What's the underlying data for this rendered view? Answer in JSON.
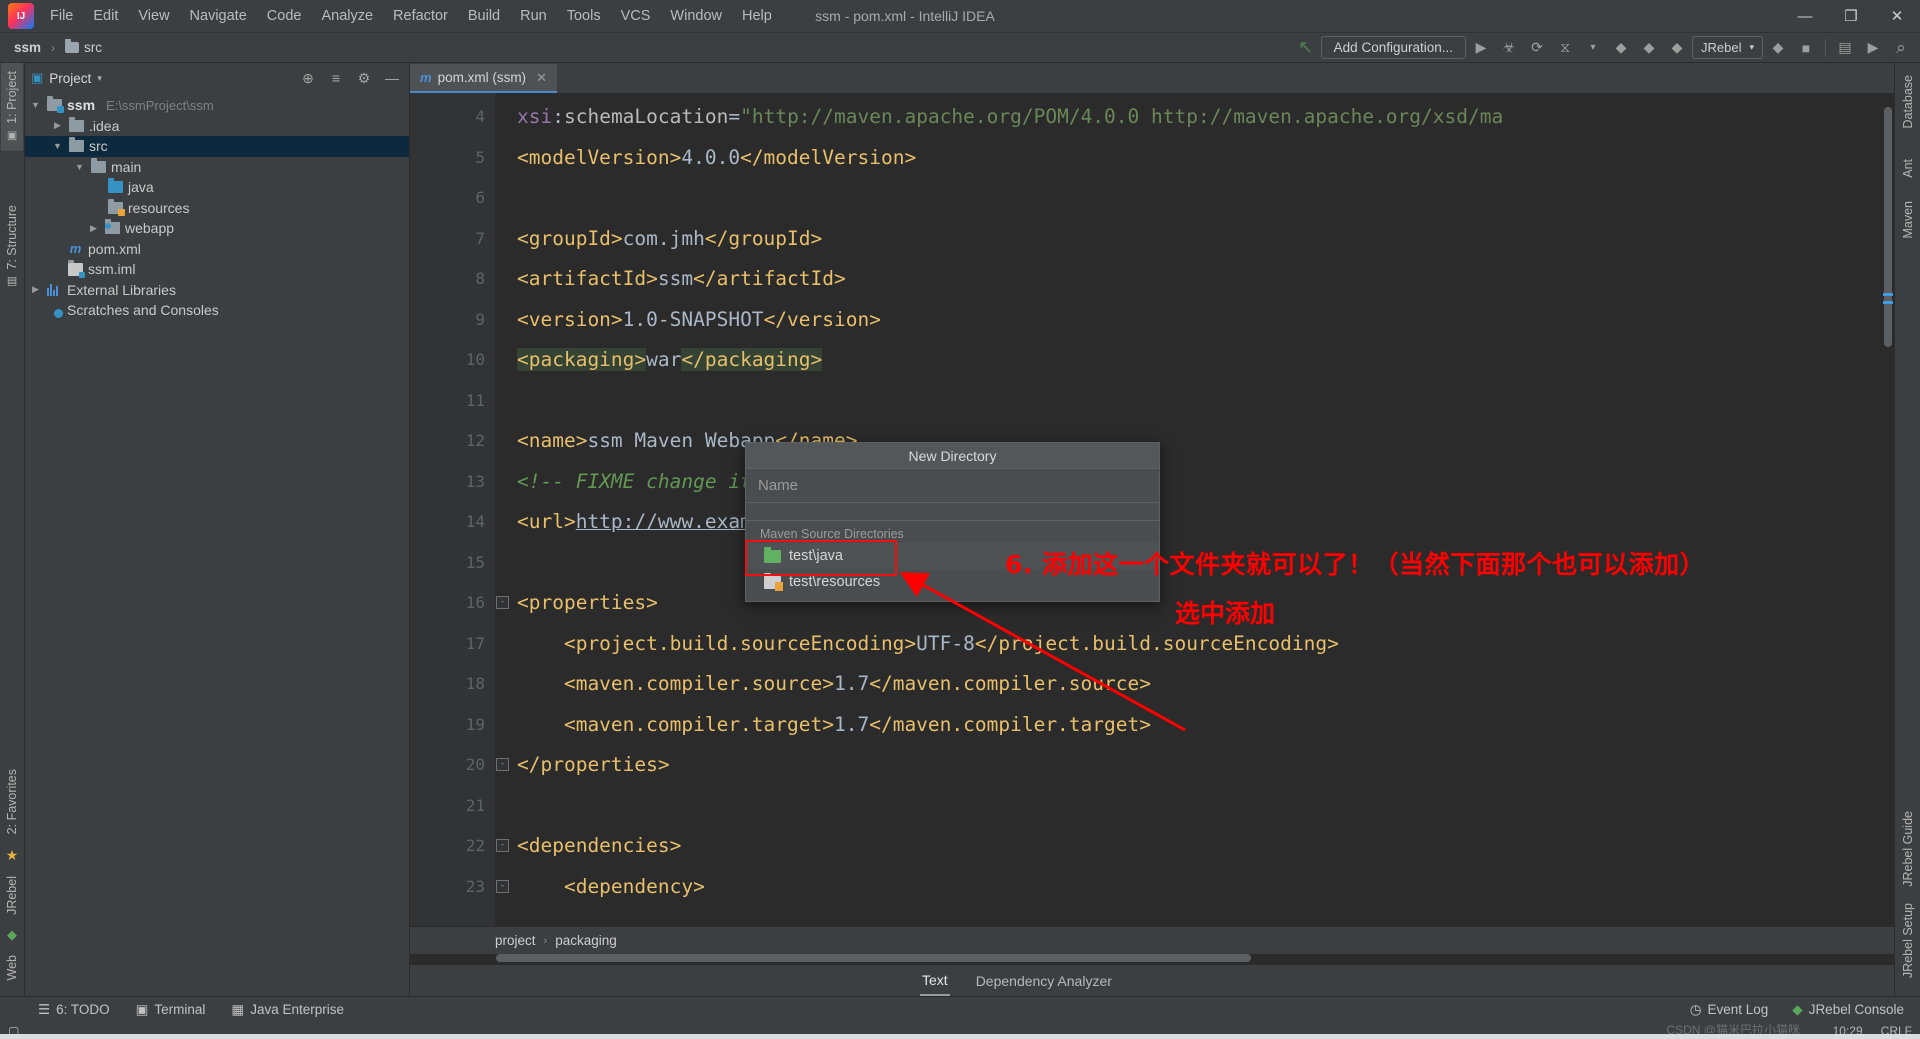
{
  "window": {
    "title": "ssm - pom.xml - IntelliJ IDEA",
    "logo_text": "IJ",
    "minimize": "—",
    "maximize": "❐",
    "close": "✕"
  },
  "menu": [
    {
      "label": "File"
    },
    {
      "label": "Edit"
    },
    {
      "label": "View"
    },
    {
      "label": "Navigate"
    },
    {
      "label": "Code"
    },
    {
      "label": "Analyze"
    },
    {
      "label": "Refactor"
    },
    {
      "label": "Build"
    },
    {
      "label": "Run"
    },
    {
      "label": "Tools"
    },
    {
      "label": "VCS"
    },
    {
      "label": "Window"
    },
    {
      "label": "Help"
    }
  ],
  "navbar": {
    "breadcrumb": [
      {
        "label": "ssm"
      },
      {
        "label": "src"
      }
    ],
    "separator": "›",
    "add_configuration": "Add Configuration...",
    "jrebel_label": "JRebel",
    "dropdown_caret": "▾",
    "icons": [
      {
        "name": "run-button",
        "glyph": "▶"
      },
      {
        "name": "debug-button",
        "glyph": "☣"
      },
      {
        "name": "run-with-coverage-button",
        "glyph": "⟳"
      },
      {
        "name": "profiler-button",
        "glyph": "⧖"
      },
      {
        "name": "profiler-dropdown",
        "glyph": "▾"
      },
      {
        "name": "jrebel-run-button",
        "glyph": "◆"
      },
      {
        "name": "jrebel-debug-button",
        "glyph": "◆"
      },
      {
        "name": "jrebel-coverage-button",
        "glyph": "◆"
      }
    ],
    "right_icons": [
      {
        "name": "jrebel-stop-icon",
        "glyph": "◆"
      },
      {
        "name": "stop-icon",
        "glyph": "■"
      },
      {
        "name": "layout-icon",
        "glyph": "▤"
      },
      {
        "name": "updates-icon",
        "glyph": "▶"
      },
      {
        "name": "search-everywhere-icon",
        "glyph": "⌕"
      }
    ],
    "undo_icon": "↖"
  },
  "left_strip": [
    {
      "label": "1: Project",
      "icon": "project-icon",
      "active": true
    },
    {
      "label": "7: Structure",
      "icon": "structure-icon",
      "active": false
    },
    {
      "label": "2: Favorites",
      "icon": "star-icon",
      "active": false
    },
    {
      "label": "JRebel",
      "icon": "jrebel-icon",
      "active": false
    },
    {
      "label": "Web",
      "icon": "web-icon",
      "active": false
    }
  ],
  "right_strip": [
    {
      "label": "Database",
      "icon": "database-icon"
    },
    {
      "label": "Ant",
      "icon": "ant-icon"
    },
    {
      "label": "Maven",
      "icon": "maven-icon"
    },
    {
      "label": "JRebel Guide",
      "icon": "jrebel-guide-icon"
    },
    {
      "label": "JRebel Setup",
      "icon": "jrebel-setup-icon"
    }
  ],
  "project_panel": {
    "title": "Project",
    "caret": "▾",
    "header_icons": [
      {
        "name": "scroll-from-source-icon",
        "glyph": "⊕"
      },
      {
        "name": "collapse-all-icon",
        "glyph": "≡"
      },
      {
        "name": "settings-gear-icon",
        "glyph": "⚙"
      },
      {
        "name": "hide-panel-icon",
        "glyph": "—"
      }
    ],
    "tree": [
      {
        "label": "ssm",
        "path": "E:\\ssmProject\\ssm",
        "indent": 0,
        "arrow": "▼",
        "icon": "module-folder",
        "bold": true,
        "selected": false
      },
      {
        "label": ".idea",
        "path": "",
        "indent": 1,
        "arrow": "▶",
        "icon": "folder-grey",
        "bold": false,
        "selected": false
      },
      {
        "label": "src",
        "path": "",
        "indent": 1,
        "arrow": "▼",
        "icon": "folder-grey",
        "bold": false,
        "selected": true
      },
      {
        "label": "main",
        "path": "",
        "indent": 2,
        "arrow": "▼",
        "icon": "folder-grey",
        "bold": false,
        "selected": false
      },
      {
        "label": "java",
        "path": "",
        "indent": 3,
        "arrow": "",
        "icon": "folder-blue",
        "bold": false,
        "selected": false
      },
      {
        "label": "resources",
        "path": "",
        "indent": 3,
        "arrow": "",
        "icon": "folder-resources",
        "bold": false,
        "selected": false
      },
      {
        "label": "webapp",
        "path": "",
        "indent": 2,
        "arrow": "▶",
        "icon": "folder-web",
        "bold": false,
        "selected": false
      },
      {
        "label": "pom.xml",
        "path": "",
        "indent": 1,
        "arrow": "",
        "icon": "maven-file",
        "bold": false,
        "selected": false
      },
      {
        "label": "ssm.iml",
        "path": "",
        "indent": 1,
        "arrow": "",
        "icon": "iml-file",
        "bold": false,
        "selected": false
      },
      {
        "label": "External Libraries",
        "path": "",
        "indent": 0,
        "arrow": "▶",
        "icon": "libraries",
        "bold": false,
        "selected": false
      },
      {
        "label": "Scratches and Consoles",
        "path": "",
        "indent": 0,
        "arrow": "",
        "icon": "scratches",
        "bold": false,
        "selected": false
      }
    ]
  },
  "editor": {
    "tab": {
      "label": "pom.xml (ssm)",
      "icon": "maven-file-icon",
      "close": "✕"
    },
    "first_line_number": 4,
    "lines": [
      {
        "n": 4,
        "fold": ""
      },
      {
        "n": 5,
        "fold": ""
      },
      {
        "n": 6,
        "fold": ""
      },
      {
        "n": 7,
        "fold": ""
      },
      {
        "n": 8,
        "fold": ""
      },
      {
        "n": 9,
        "fold": ""
      },
      {
        "n": 10,
        "fold": ""
      },
      {
        "n": 11,
        "fold": ""
      },
      {
        "n": 12,
        "fold": ""
      },
      {
        "n": 13,
        "fold": ""
      },
      {
        "n": 14,
        "fold": ""
      },
      {
        "n": 15,
        "fold": ""
      },
      {
        "n": 16,
        "fold": "-"
      },
      {
        "n": 17,
        "fold": ""
      },
      {
        "n": 18,
        "fold": ""
      },
      {
        "n": 19,
        "fold": ""
      },
      {
        "n": 20,
        "fold": "-"
      },
      {
        "n": 21,
        "fold": ""
      },
      {
        "n": 22,
        "fold": "-"
      },
      {
        "n": 23,
        "fold": "-"
      }
    ],
    "code_lines": [
      "    xsi:schemaLocation=\"http://maven.apache.org/POM/4.0.0 http://maven.apache.org/xsd/ma",
      "    <modelVersion>4.0.0</modelVersion>",
      "",
      "    <groupId>com.jmh</groupId>",
      "    <artifactId>ssm</artifactId>",
      "    <version>1.0-SNAPSHOT</version>",
      "    <packaging>war</packaging>",
      "",
      "    <name>ssm Maven Webapp</name>",
      "    <!-- FIXME change it to the project's website -->",
      "    <url>http://www.example.com</url>",
      "",
      "    <properties>",
      "        <project.build.sourceEncoding>UTF-8</project.build.sourceEncoding>",
      "        <maven.compiler.source>1.7</maven.compiler.source>",
      "        <maven.compiler.target>1.7</maven.compiler.target>",
      "    </properties>",
      "",
      "    <dependencies>",
      "        <dependency>"
    ],
    "breadcrumb": [
      {
        "label": "project"
      },
      {
        "label": "packaging"
      }
    ],
    "breadcrumb_sep": "›",
    "bottom_tabs": [
      {
        "label": "Text",
        "active": true
      },
      {
        "label": "Dependency Analyzer",
        "active": false
      }
    ]
  },
  "dialog": {
    "title": "New Directory",
    "name_placeholder": "Name",
    "name_value": "",
    "group_label": "Maven Source Directories",
    "items": [
      {
        "label": "test\\java",
        "icon": "green-folder-icon",
        "selected": true
      },
      {
        "label": "test\\resources",
        "icon": "resources-folder-icon",
        "selected": false
      }
    ]
  },
  "annotations": {
    "note_main": "6. 添加这一个文件夹就可以了！（当然下面那个也可以添加）",
    "note_sub": "选中添加",
    "highlight_color": "#ff0000"
  },
  "statusbar": {
    "left_items": [
      {
        "label": "6: TODO",
        "icon": "todo-icon"
      },
      {
        "label": "Terminal",
        "icon": "terminal-icon"
      },
      {
        "label": "Java Enterprise",
        "icon": "java-enterprise-icon"
      }
    ],
    "right_items": [
      {
        "label": "Event Log",
        "icon": "event-log-icon"
      },
      {
        "label": "JRebel Console",
        "icon": "jrebel-console-icon"
      }
    ],
    "time": "10:29",
    "line_sep": "CRLF",
    "watermark": "CSDN @猫米巴拉小猫咪"
  }
}
